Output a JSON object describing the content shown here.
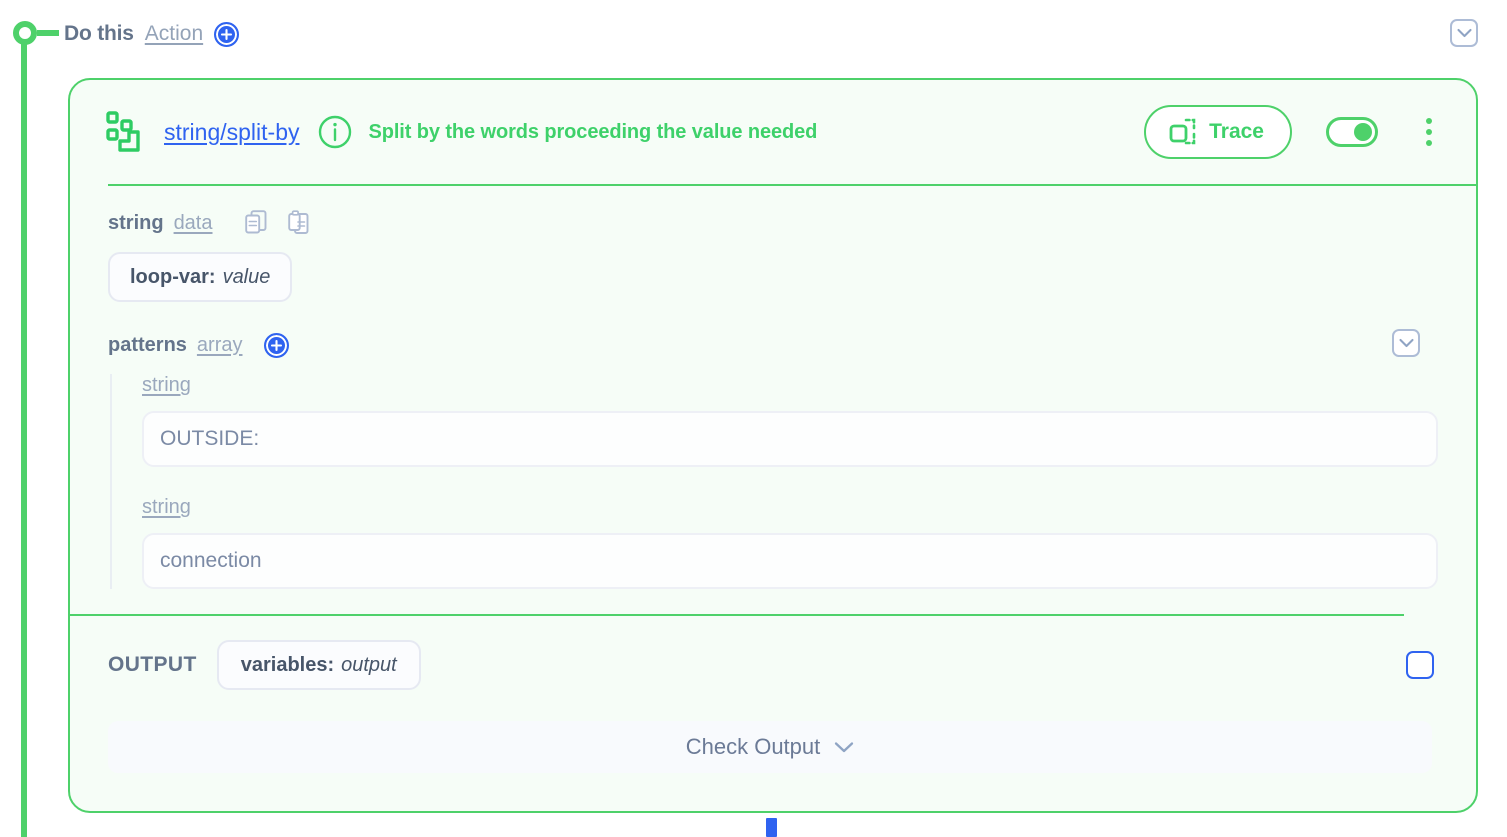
{
  "flow": {
    "step_label": "Do this",
    "step_type": "Action",
    "add_action_icon": "plus-circle-icon",
    "collapse_icon": "chevron-down-icon",
    "node_dot_icon": "flow-node-icon"
  },
  "card": {
    "icon": "split-blocks-icon",
    "name": "string/split-by",
    "info_icon": "info-circle-icon",
    "description": "Split by the words proceeding the value needed",
    "trace": {
      "label": "Trace",
      "icon": "trace-frame-icon"
    },
    "toggle": {
      "icon": "toggle-on-icon",
      "state": "on"
    },
    "menu_icon": "kebab-menu-icon"
  },
  "fields": {
    "string": {
      "key": "string",
      "type": "data",
      "copy_icon": "copy-icon",
      "paste_icon": "paste-icon",
      "value_pill": {
        "name": "loop-var:",
        "value": "value"
      }
    },
    "patterns": {
      "key": "patterns",
      "type": "array",
      "add_icon": "plus-circle-icon",
      "collapse_icon": "chevron-down-icon",
      "items": [
        {
          "type": "string",
          "value": "OUTSIDE:"
        },
        {
          "type": "string",
          "value": "connection"
        }
      ]
    }
  },
  "output": {
    "label": "OUTPUT",
    "pill": {
      "name": "variables:",
      "value": "output"
    },
    "checkbox_state": "unchecked"
  },
  "check_output": {
    "label": "Check Output",
    "icon": "chevron-down-icon"
  },
  "colors": {
    "green": "#4ed16a",
    "green_text": "#3ed16a",
    "blue": "#2f63f0",
    "slate": "#64748b",
    "card_bg": "#f6fdf7"
  }
}
